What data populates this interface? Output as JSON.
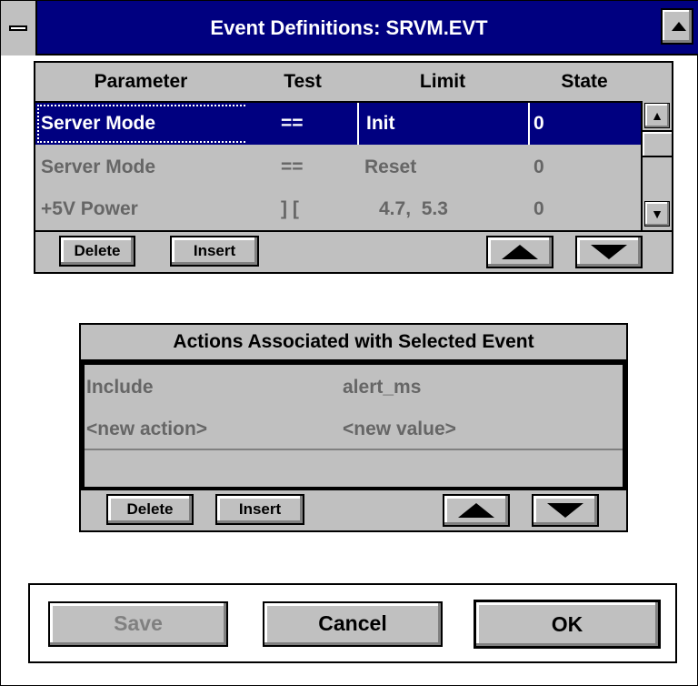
{
  "window": {
    "title": "Event Definitions: SRVM.EVT"
  },
  "events": {
    "columns": [
      "Parameter",
      "Test",
      "Limit",
      "State"
    ],
    "rows": [
      {
        "parameter": "Server Mode",
        "test": "==",
        "limit": "Init",
        "state": "0",
        "selected": true
      },
      {
        "parameter": "Server Mode",
        "test": "==",
        "limit": "Reset",
        "state": "0",
        "selected": false
      },
      {
        "parameter": "+5V Power",
        "test": "] [",
        "limit": "4.7,  5.3",
        "state": "0",
        "selected": false
      }
    ],
    "delete_label": "Delete",
    "insert_label": "Insert"
  },
  "actions": {
    "title": "Actions Associated with Selected Event",
    "rows": [
      {
        "action": "Include",
        "value": "alert_ms"
      },
      {
        "action": "<new action>",
        "value": "<new value>"
      }
    ],
    "delete_label": "Delete",
    "insert_label": "Insert"
  },
  "footer": {
    "save_label": "Save",
    "cancel_label": "Cancel",
    "ok_label": "OK"
  },
  "colors": {
    "title_bar": "#000080",
    "face": "#c0c0c0",
    "selection": "#000080",
    "disabled_text": "#808080"
  }
}
